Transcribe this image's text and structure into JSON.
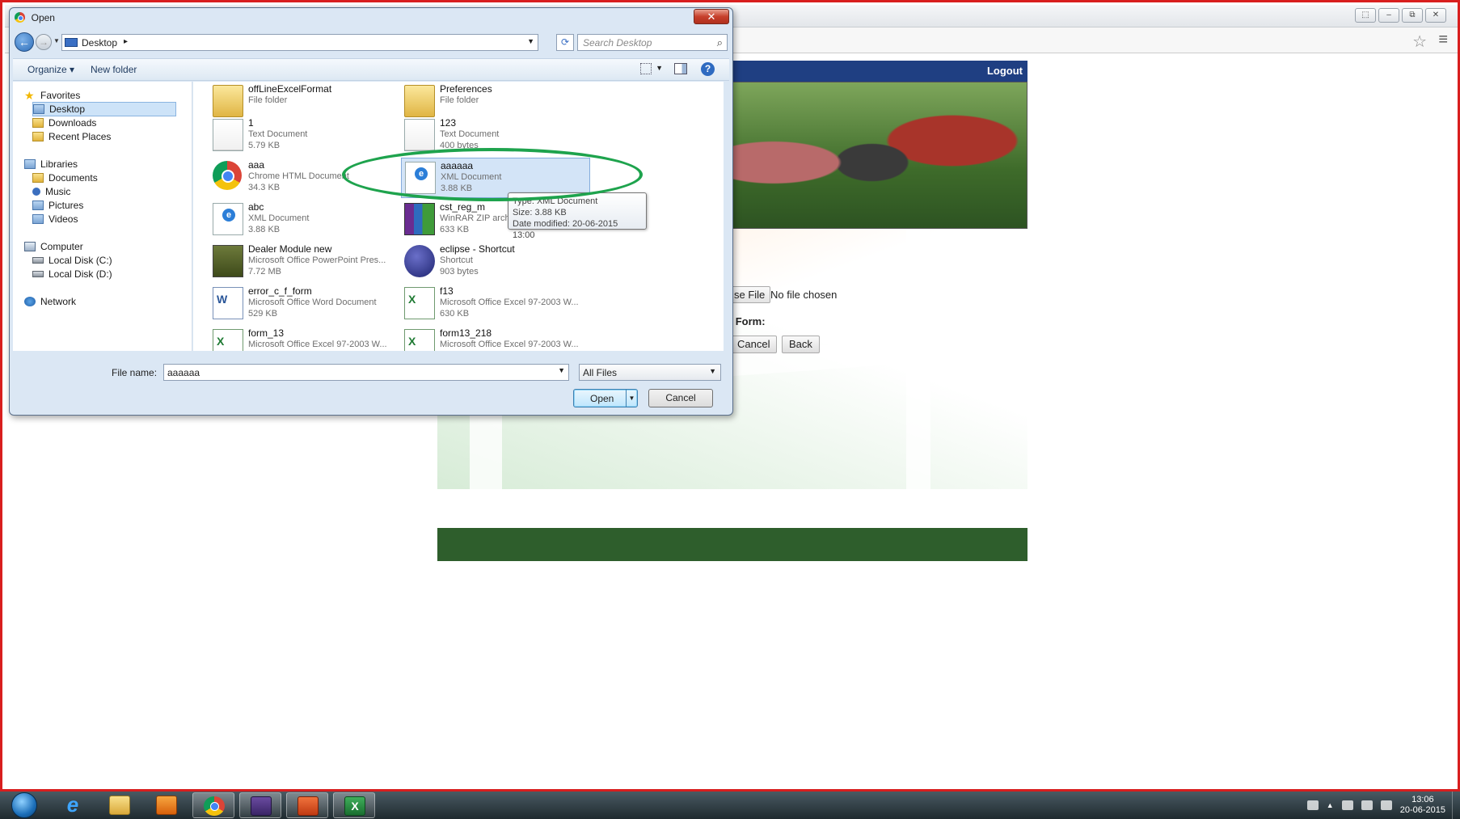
{
  "browser": {
    "tab_title": "",
    "window_buttons": [
      "⬚",
      "–",
      "⧉",
      "✕"
    ]
  },
  "page": {
    "logout": "Logout",
    "choose_file": "se File",
    "no_file": "No file chosen",
    "form_label": "' Form:",
    "cancel": "Cancel",
    "back": "Back"
  },
  "dialog": {
    "title": "Open",
    "close": "✕",
    "address": "Desktop",
    "search_placeholder": "Search Desktop",
    "organize": "Organize ▾",
    "new_folder": "New folder",
    "help": "?",
    "nav": [
      {
        "label": "Favorites",
        "kind": "star",
        "indent": 0
      },
      {
        "label": "Desktop",
        "kind": "lib",
        "indent": 1,
        "selected": true
      },
      {
        "label": "Downloads",
        "kind": "folder",
        "indent": 1
      },
      {
        "label": "Recent Places",
        "kind": "folder",
        "indent": 1
      },
      {
        "label": "Libraries",
        "kind": "lib",
        "indent": 0
      },
      {
        "label": "Documents",
        "kind": "folder",
        "indent": 1
      },
      {
        "label": "Music",
        "kind": "music",
        "indent": 1
      },
      {
        "label": "Pictures",
        "kind": "lib",
        "indent": 1
      },
      {
        "label": "Videos",
        "kind": "lib",
        "indent": 1
      },
      {
        "label": "Computer",
        "kind": "pc",
        "indent": 0
      },
      {
        "label": "Local Disk (C:)",
        "kind": "disk",
        "indent": 1
      },
      {
        "label": "Local Disk (D:)",
        "kind": "disk",
        "indent": 1
      },
      {
        "label": "Network",
        "kind": "net",
        "indent": 0
      }
    ],
    "files": [
      {
        "name": "offLineExcelFormat",
        "type": "File folder",
        "size": "",
        "icon": "folder"
      },
      {
        "name": "Preferences",
        "type": "File folder",
        "size": "",
        "icon": "folder"
      },
      {
        "name": "1",
        "type": "Text Document",
        "size": "5.79 KB",
        "icon": "text"
      },
      {
        "name": "123",
        "type": "Text Document",
        "size": "400 bytes",
        "icon": "text"
      },
      {
        "name": "aaa",
        "type": "Chrome HTML Document",
        "size": "34.3 KB",
        "icon": "chrome"
      },
      {
        "name": "aaaaaa",
        "type": "XML Document",
        "size": "3.88 KB",
        "icon": "xml",
        "selected": true
      },
      {
        "name": "abc",
        "type": "XML Document",
        "size": "3.88 KB",
        "icon": "xml"
      },
      {
        "name": "cst_reg_m",
        "type": "WinRAR ZIP archive",
        "size": "633 KB",
        "icon": "rar"
      },
      {
        "name": "Dealer Module new",
        "type": "Microsoft Office PowerPoint Pres...",
        "size": "7.72 MB",
        "icon": "ppt"
      },
      {
        "name": "eclipse - Shortcut",
        "type": "Shortcut",
        "size": "903 bytes",
        "icon": "shortcut"
      },
      {
        "name": "error_c_f_form",
        "type": "Microsoft Office Word Document",
        "size": "529 KB",
        "icon": "word"
      },
      {
        "name": "f13",
        "type": "Microsoft Office Excel 97-2003 W...",
        "size": "630 KB",
        "icon": "excel"
      },
      {
        "name": "form_13",
        "type": "Microsoft Office Excel 97-2003 W...",
        "size": "",
        "icon": "excel"
      },
      {
        "name": "form13_218",
        "type": "Microsoft Office Excel 97-2003 W...",
        "size": "",
        "icon": "excel"
      }
    ],
    "tooltip": {
      "type_line": "Type: XML Document",
      "size_line": "Size: 3.88 KB",
      "date_line": "Date modified: 20-06-2015 13:00"
    },
    "filename_label": "File name:",
    "filename_value": "aaaaaa",
    "filter": "All Files",
    "open": "Open",
    "cancel": "Cancel"
  },
  "taskbar": {
    "apps": [
      "internet-explorer",
      "windows-explorer",
      "media-player",
      "chrome",
      "java-app",
      "powerpoint",
      "excel"
    ],
    "excel_glyph": "X",
    "ie_glyph": "e",
    "clock_time": "13:06",
    "clock_date": "20-06-2015"
  }
}
